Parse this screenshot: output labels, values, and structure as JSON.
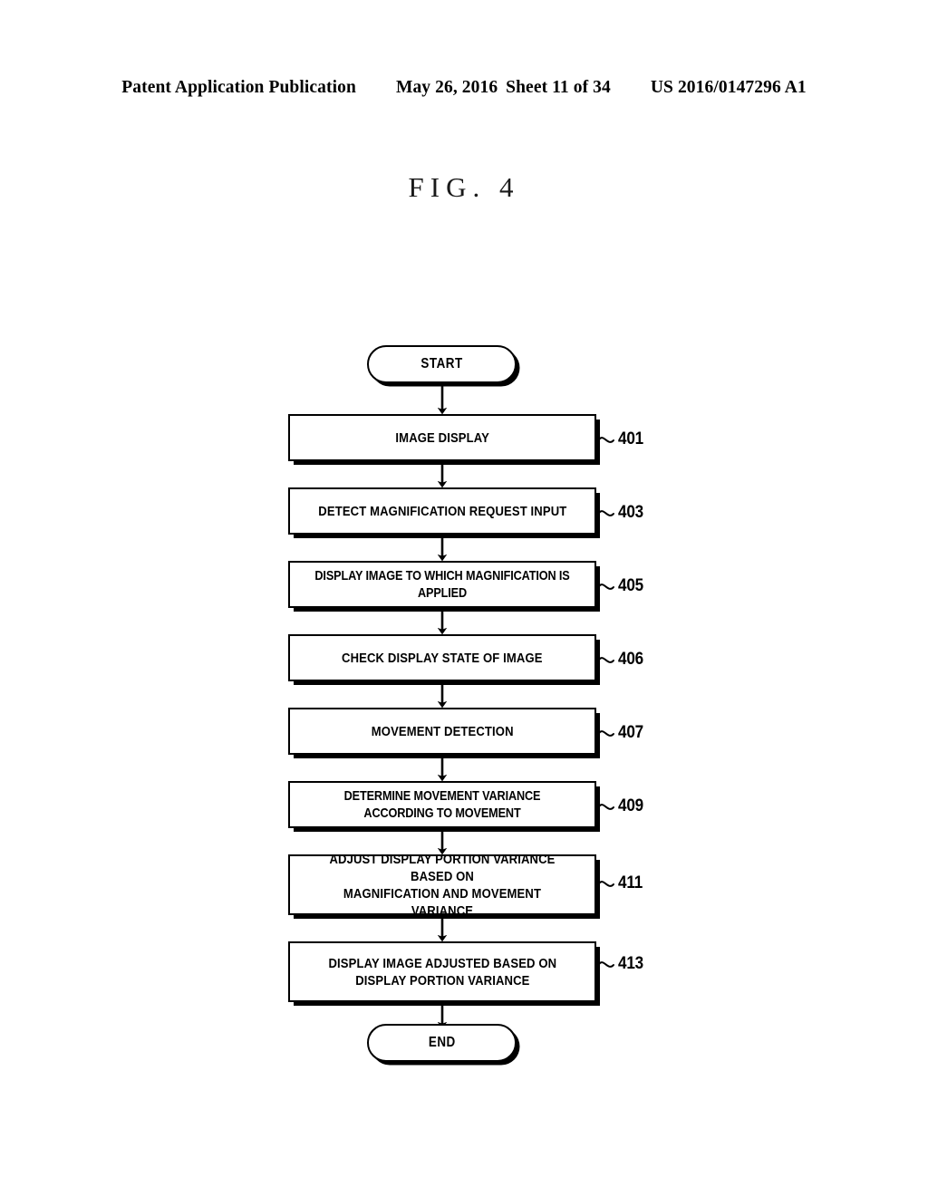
{
  "header": {
    "publication": "Patent Application Publication",
    "date": "May 26, 2016",
    "sheet": "Sheet 11 of 34",
    "patent_number": "US 2016/0147296 A1"
  },
  "figure": {
    "title": "FIG. 4"
  },
  "flowchart": {
    "start_label": "START",
    "end_label": "END",
    "steps": [
      {
        "ref": "401",
        "label": "IMAGE DISPLAY"
      },
      {
        "ref": "403",
        "label": "DETECT MAGNIFICATION REQUEST INPUT"
      },
      {
        "ref": "405",
        "label": "DISPLAY IMAGE TO WHICH MAGNIFICATION IS APPLIED"
      },
      {
        "ref": "406",
        "label": "CHECK DISPLAY STATE OF IMAGE"
      },
      {
        "ref": "407",
        "label": "MOVEMENT DETECTION"
      },
      {
        "ref": "409",
        "label": "DETERMINE MOVEMENT VARIANCE ACCORDING TO MOVEMENT"
      },
      {
        "ref": "411",
        "label": "ADJUST DISPLAY PORTION VARIANCE BASED ON\nMAGNIFICATION AND MOVEMENT VARIANCE"
      },
      {
        "ref": "413",
        "label": "DISPLAY IMAGE ADJUSTED BASED ON\nDISPLAY PORTION VARIANCE"
      }
    ]
  },
  "colors": {
    "ink": "#000000",
    "paper": "#ffffff"
  }
}
